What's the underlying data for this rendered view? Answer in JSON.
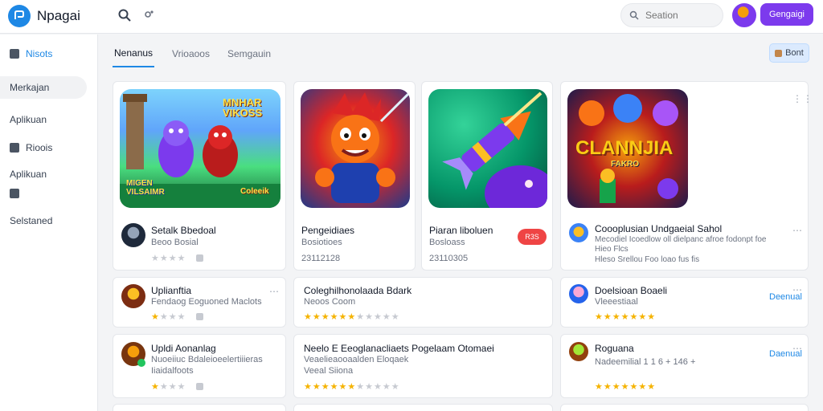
{
  "app": {
    "name": "Npagai"
  },
  "search": {
    "placeholder": "Seation"
  },
  "top": {
    "button_label": "Gengaigi"
  },
  "sidebar": {
    "items": [
      {
        "label": "Nisots"
      },
      {
        "label": "Merkajan"
      },
      {
        "label": "Aplikuan"
      },
      {
        "label": "Rioois"
      },
      {
        "label": "Aplikuan"
      },
      {
        "label": "Selstaned"
      }
    ]
  },
  "tabs": [
    {
      "label": "Nenanus"
    },
    {
      "label": "Vrioaoos"
    },
    {
      "label": "Semgauin"
    }
  ],
  "filter": {
    "label": "Bont"
  },
  "featured": [
    {
      "art_text": "MNHAR VIKOSS",
      "art_caption": "MIGEN VILSAIMR",
      "art_badge": "Coleeik",
      "title": "Setalk Bbedoal",
      "subtitle": "Beoo Bosial",
      "rating": 0
    },
    {
      "title": "Pengeidiaes",
      "subtitle": "Bosiotioes",
      "meta": "23112128"
    },
    {
      "title": "Piaran liboluen",
      "subtitle": "Bosloass",
      "meta": "23110305",
      "badge": "R3S"
    },
    {
      "art_text": "CLANNJIA",
      "art_caption": "FAKRO",
      "title": "Coooplusian Undgaeial Sahol",
      "subtitle": "Mecodiel Icoedlow oll dielpanc afroe fodonpt foe",
      "meta": "Hieo Flcs",
      "meta2": "Hleso Srellou Foo loao fus fis"
    }
  ],
  "list_rows": [
    {
      "title": "Uplianftia",
      "subtitle": "Fendaog Eoguoned Maclots",
      "rating": 1
    },
    {
      "title": "Coleghilhonolaada Bdark",
      "subtitle": "Neoos Coom",
      "rating": 6
    },
    {
      "title": "Doelsioan Boaeli",
      "subtitle": "Vleeestiaal",
      "rating": 7,
      "action": "Deenual"
    },
    {
      "title": "Upldi Aonanlag",
      "subtitle": "Nuoeiiuc Bdaleioeelertiiieras",
      "meta": "Iiaidalfoots",
      "rating": 1
    },
    {
      "title": "Neelo E Eeoglanacliaets Pogelaam Otomaei",
      "subtitle": "Veaelieaooaalden Eloqaek",
      "meta": "Veeal Siiona",
      "rating": 6
    },
    {
      "title": "Roguana",
      "subtitle": "Nadeemilial 1 1 6 + 146 +",
      "rating": 7,
      "action": "Daenual"
    }
  ],
  "colors": {
    "accent": "#1e88e5",
    "brand": "#7c3aed",
    "star": "#f5b301",
    "danger": "#ef4444"
  }
}
